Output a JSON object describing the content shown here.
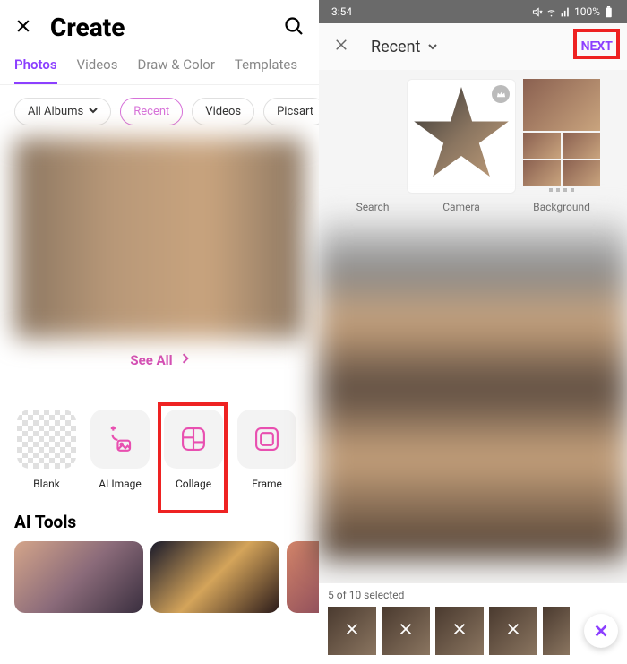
{
  "left": {
    "header": {
      "title": "Create"
    },
    "tabs": [
      {
        "label": "Photos",
        "active": true
      },
      {
        "label": "Videos"
      },
      {
        "label": "Draw & Color"
      },
      {
        "label": "Templates"
      }
    ],
    "filters": {
      "all_albums": "All Albums",
      "recent": "Recent",
      "videos": "Videos",
      "picsart": "Picsart"
    },
    "see_all": "See All",
    "tools": {
      "blank": "Blank",
      "ai_image": "AI Image",
      "collage": "Collage",
      "frame": "Frame"
    },
    "ai_tools_title": "AI Tools"
  },
  "right": {
    "status": {
      "time": "3:54",
      "battery": "100%"
    },
    "picker": {
      "title": "Recent",
      "next": "NEXT"
    },
    "sources": {
      "search": "Search",
      "camera": "Camera",
      "background": "Background"
    },
    "selection": {
      "count": "5 of 10 selected"
    }
  },
  "colors": {
    "accent": "#8c3fff",
    "pink": "#d44eb5",
    "highlight": "#e22"
  }
}
